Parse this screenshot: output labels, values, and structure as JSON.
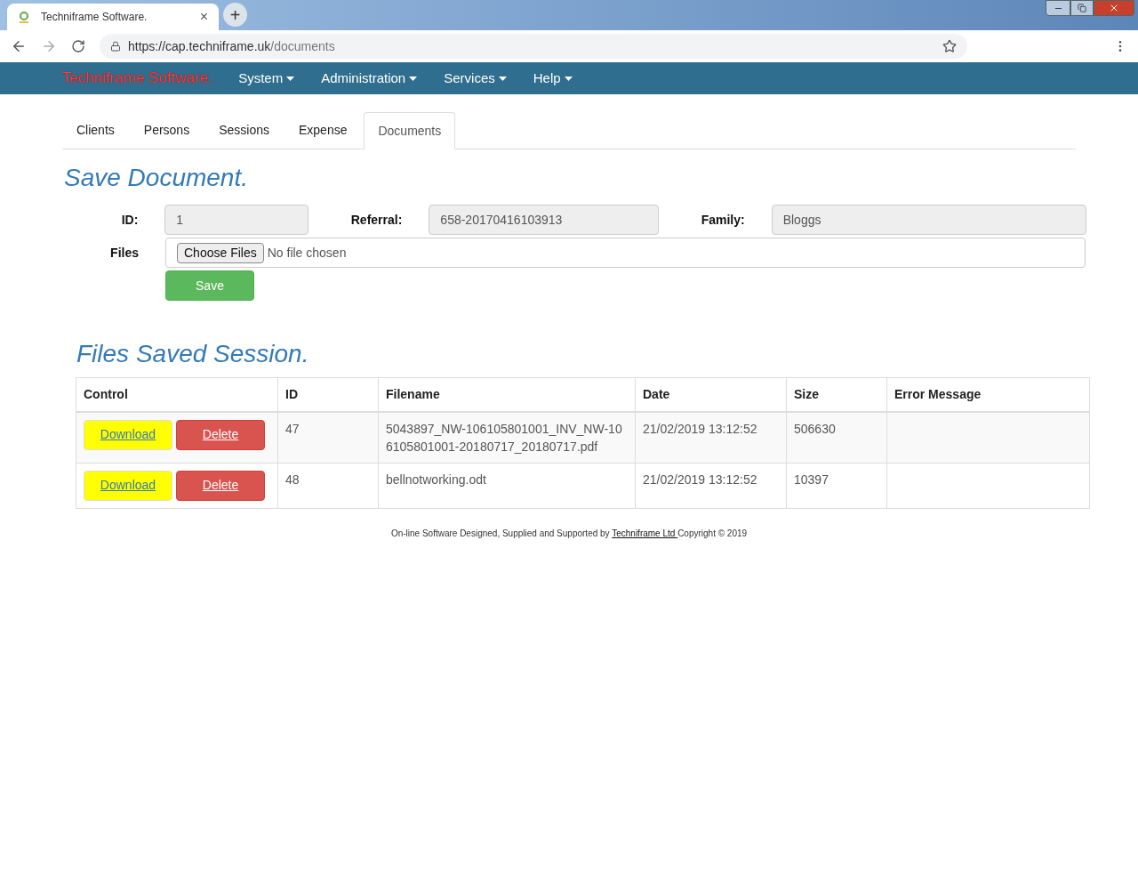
{
  "browser": {
    "tab_title": "Techniframe Software.",
    "tab_close": "×",
    "new_tab": "+",
    "url_host": "https://cap.techniframe.uk",
    "url_path": "/documents"
  },
  "navbar": {
    "brand": "Techniframe Software.",
    "menus": [
      "System",
      "Administration",
      "Services",
      "Help"
    ]
  },
  "tabs": [
    {
      "label": "Clients",
      "selected": false
    },
    {
      "label": "Persons",
      "selected": false
    },
    {
      "label": "Sessions",
      "selected": false
    },
    {
      "label": "Expense",
      "selected": false
    },
    {
      "label": "Documents",
      "selected": true
    }
  ],
  "form": {
    "title": "Save Document.",
    "id_label": "ID:",
    "id_value": "1",
    "referral_label": "Referral:",
    "referral_value": "658-20170416103913",
    "family_label": "Family:",
    "family_value": "Bloggs",
    "files_label": "Files",
    "choose_button": "Choose Files",
    "no_file": "No file chosen",
    "save_button": "Save"
  },
  "files": {
    "title": "Files Saved Session.",
    "columns": [
      "Control",
      "ID",
      "Filename",
      "Date",
      "Size",
      "Error Message"
    ],
    "rows": [
      {
        "download_label": "Download",
        "delete_label": "Delete",
        "id": "47",
        "filename": "5043897_NW-106105801001_INV_NW-106105801001-20180717_20180717.pdf",
        "date": "21/02/2019 13:12:52",
        "size": "506630",
        "error": ""
      },
      {
        "download_label": "Download",
        "delete_label": "Delete",
        "id": "48",
        "filename": "bellnotworking.odt",
        "date": "21/02/2019 13:12:52",
        "size": "10397",
        "error": ""
      }
    ]
  },
  "footer": {
    "before": "On-line Software Designed, Supplied and Supported by ",
    "link": "Techniframe Ltd ",
    "after": "Copyright © 2019"
  }
}
